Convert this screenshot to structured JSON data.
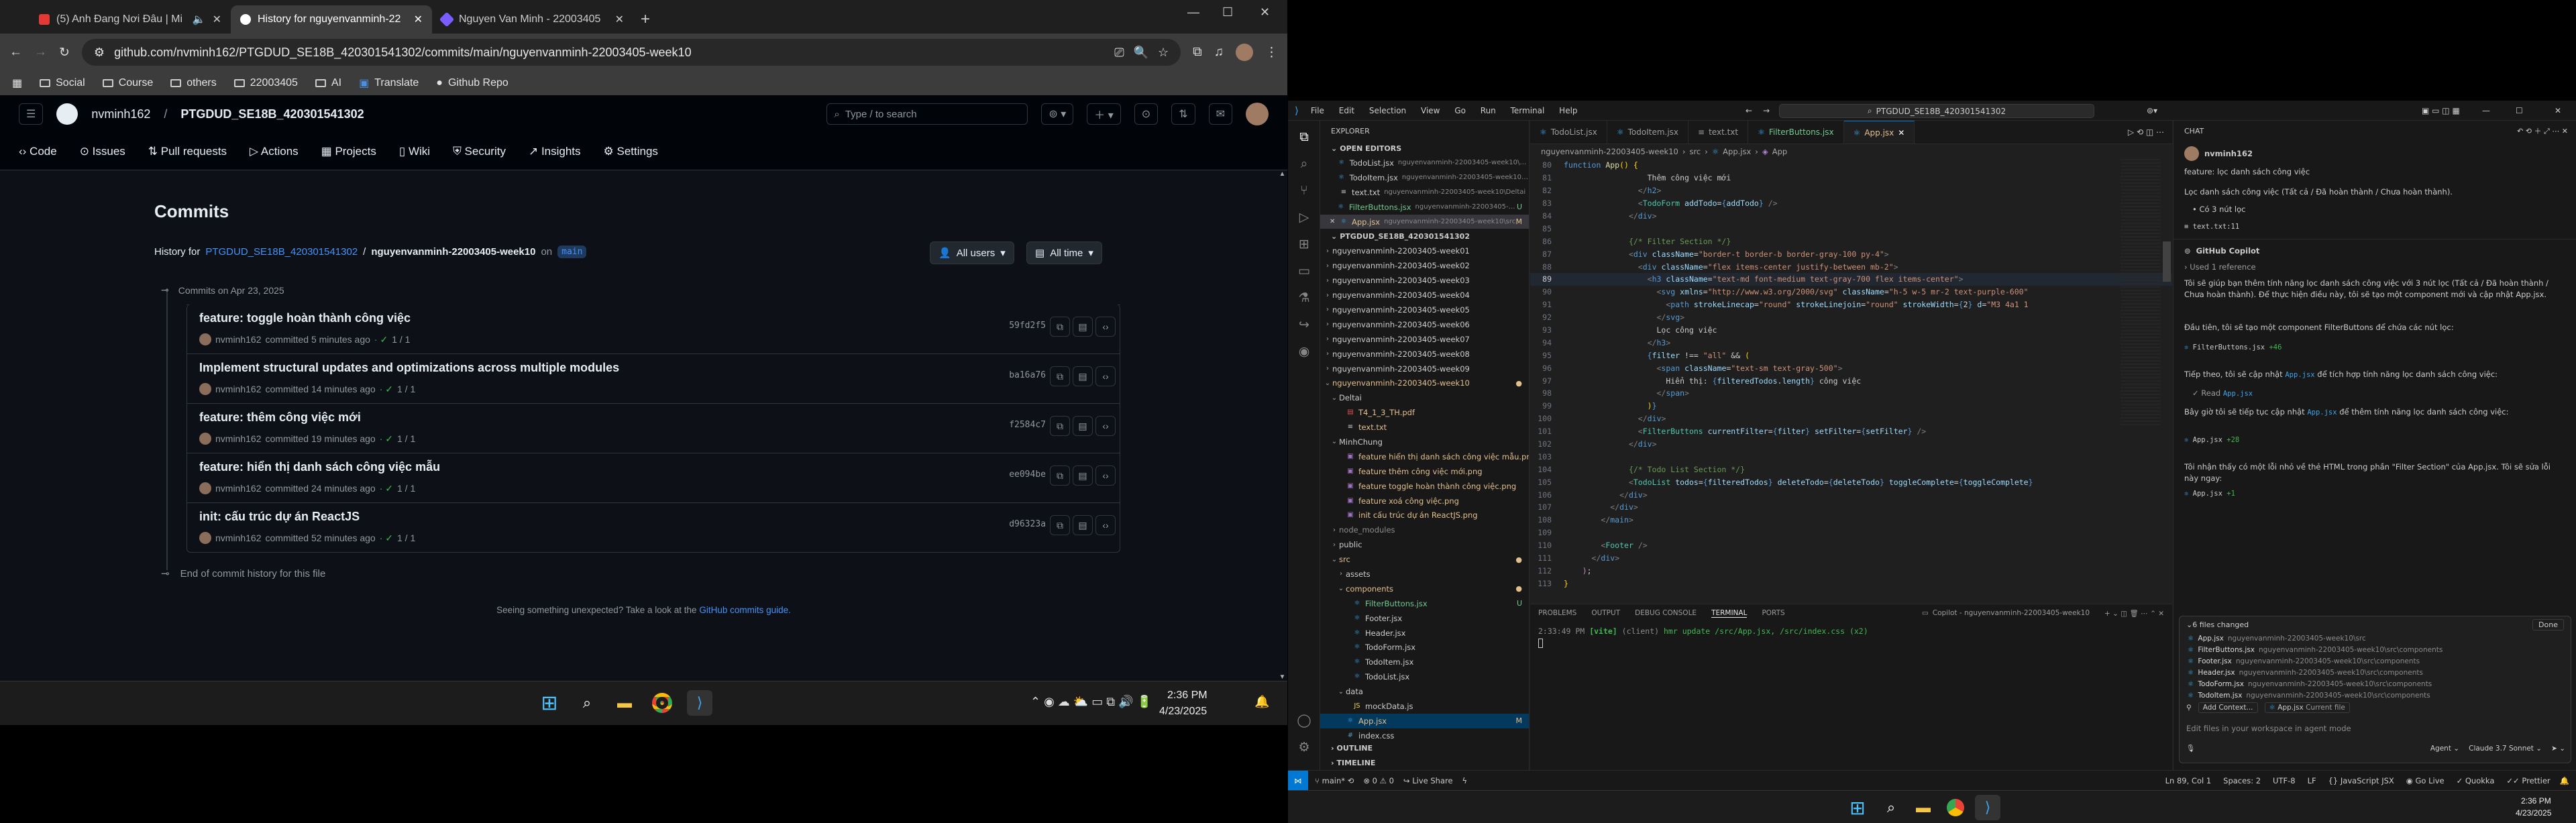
{
  "browser": {
    "tabs": [
      {
        "label": "(5) Anh Đang Nơi Đâu | Mi",
        "active": false
      },
      {
        "label": "History for nguyenvanminh-22",
        "active": true
      },
      {
        "label": "Nguyen Van Minh - 22003405",
        "active": false
      }
    ],
    "new_tab": "+",
    "url": "github.com/nvminh162/PTGDUD_SE18B_420301541302/commits/main/nguyenvanminh-22003405-week10",
    "bookmarks": [
      "Social",
      "Course",
      "others",
      "22003405",
      "AI",
      "Translate",
      "Github Repo"
    ]
  },
  "github": {
    "owner": "nvminh162",
    "repo": "PTGDUD_SE18B_420301541302",
    "search_placeholder": "Type / to search",
    "nav": [
      "Code",
      "Issues",
      "Pull requests",
      "Actions",
      "Projects",
      "Wiki",
      "Security",
      "Insights",
      "Settings"
    ],
    "page_title": "Commits",
    "history_label": "History for",
    "history_repo": "PTGDUD_SE18B_420301541302",
    "history_sep": "/",
    "history_path": "nguyenvanminh-22003405-week10",
    "history_on": "on",
    "branch": "main",
    "filter_users": "All users",
    "filter_time": "All time",
    "commits_date": "Commits on Apr 23, 2025",
    "commits": [
      {
        "title": "feature: toggle hoàn thành công việc",
        "author": "nvminh162",
        "time": "committed 5 minutes ago",
        "checks": "1 / 1",
        "sha": "59fd2f5"
      },
      {
        "title": "Implement structural updates and optimizations across multiple modules",
        "author": "nvminh162",
        "time": "committed 14 minutes ago",
        "checks": "1 / 1",
        "sha": "ba16a76"
      },
      {
        "title": "feature: thêm công việc mới",
        "author": "nvminh162",
        "time": "committed 19 minutes ago",
        "checks": "1 / 1",
        "sha": "f2584c7"
      },
      {
        "title": "feature: hiển thị danh sách công việc mẫu",
        "author": "nvminh162",
        "time": "committed 24 minutes ago",
        "checks": "1 / 1",
        "sha": "ee094be"
      },
      {
        "title": "init: cấu trúc dự án ReactJS",
        "author": "nvminh162",
        "time": "committed 52 minutes ago",
        "checks": "1 / 1",
        "sha": "d96323a"
      }
    ],
    "end_history": "End of commit history for this file",
    "footer_text": "Seeing something unexpected? Take a look at the",
    "footer_link": "GitHub commits guide."
  },
  "left_taskbar": {
    "time": "2:36 PM",
    "date": "4/23/2025"
  },
  "vscode": {
    "menu": [
      "File",
      "Edit",
      "Selection",
      "View",
      "Go",
      "Run",
      "Terminal",
      "Help"
    ],
    "search_text": "PTGDUD_SE18B_420301541302",
    "explorer_title": "EXPLORER",
    "open_editors_title": "OPEN EDITORS",
    "open_editors": [
      {
        "name": "TodoList.jsx",
        "path": "nguyenvanminh-22003405-week10\\src\\compone...",
        "badge": ""
      },
      {
        "name": "TodoItem.jsx",
        "path": "nguyenvanminh-22003405-week10\\src\\compon...",
        "badge": ""
      },
      {
        "name": "text.txt",
        "path": "nguyenvanminh-22003405-week10\\Deltai",
        "badge": ""
      },
      {
        "name": "FilterButtons.jsx",
        "path": "nguyenvanminh-22003405-week10\\src\\c...",
        "badge": "U"
      },
      {
        "name": "App.jsx",
        "path": "nguyenvanminh-22003405-week10\\src",
        "badge": "M"
      }
    ],
    "workspace_title": "PTGDUD_SE18B_420301541302",
    "tree": [
      {
        "label": "nguyenvanminh-22003405-week01",
        "depth": 1,
        "arrow": "›",
        "kind": "folder",
        "badge": ""
      },
      {
        "label": "nguyenvanminh-22003405-week02",
        "depth": 1,
        "arrow": "›",
        "kind": "folder",
        "badge": ""
      },
      {
        "label": "nguyenvanminh-22003405-week03",
        "depth": 1,
        "arrow": "›",
        "kind": "folder",
        "badge": ""
      },
      {
        "label": "nguyenvanminh-22003405-week04",
        "depth": 1,
        "arrow": "›",
        "kind": "folder",
        "badge": ""
      },
      {
        "label": "nguyenvanminh-22003405-week05",
        "depth": 1,
        "arrow": "›",
        "kind": "folder",
        "badge": ""
      },
      {
        "label": "nguyenvanminh-22003405-week06",
        "depth": 1,
        "arrow": "›",
        "kind": "folder",
        "badge": ""
      },
      {
        "label": "nguyenvanminh-22003405-week07",
        "depth": 1,
        "arrow": "›",
        "kind": "folder",
        "badge": ""
      },
      {
        "label": "nguyenvanminh-22003405-week08",
        "depth": 1,
        "arrow": "›",
        "kind": "folder",
        "badge": ""
      },
      {
        "label": "nguyenvanminh-22003405-week09",
        "depth": 1,
        "arrow": "›",
        "kind": "folder",
        "badge": ""
      },
      {
        "label": "nguyenvanminh-22003405-week10",
        "depth": 1,
        "arrow": "⌄",
        "kind": "folder",
        "badge": "●"
      },
      {
        "label": "Deltai",
        "depth": 2,
        "arrow": "⌄",
        "kind": "folder",
        "badge": ""
      },
      {
        "label": "T4_1_3_TH.pdf",
        "depth": 3,
        "arrow": "",
        "kind": "pdf",
        "badge": ""
      },
      {
        "label": "text.txt",
        "depth": 3,
        "arrow": "",
        "kind": "txt",
        "badge": ""
      },
      {
        "label": "MinhChung",
        "depth": 2,
        "arrow": "⌄",
        "kind": "folder",
        "badge": ""
      },
      {
        "label": "feature hiển thị danh sách công việc mẫu.png",
        "depth": 3,
        "arrow": "",
        "kind": "img",
        "badge": ""
      },
      {
        "label": "feature thêm công việc mới.png",
        "depth": 3,
        "arrow": "",
        "kind": "img",
        "badge": ""
      },
      {
        "label": "feature toggle hoàn thành công việc.png",
        "depth": 3,
        "arrow": "",
        "kind": "img",
        "badge": ""
      },
      {
        "label": "feature xoá công việc.png",
        "depth": 3,
        "arrow": "",
        "kind": "img",
        "badge": ""
      },
      {
        "label": "init cấu trúc dự án ReactJS.png",
        "depth": 3,
        "arrow": "",
        "kind": "img",
        "badge": ""
      },
      {
        "label": "node_modules",
        "depth": 2,
        "arrow": "›",
        "kind": "folder-dim",
        "badge": ""
      },
      {
        "label": "public",
        "depth": 2,
        "arrow": "›",
        "kind": "folder",
        "badge": ""
      },
      {
        "label": "src",
        "depth": 2,
        "arrow": "⌄",
        "kind": "folder",
        "badge": "●"
      },
      {
        "label": "assets",
        "depth": 3,
        "arrow": "›",
        "kind": "folder",
        "badge": ""
      },
      {
        "label": "components",
        "depth": 3,
        "arrow": "⌄",
        "kind": "folder-mod",
        "badge": "●"
      },
      {
        "label": "FilterButtons.jsx",
        "depth": 4,
        "arrow": "",
        "kind": "jsx-new",
        "badge": "U"
      },
      {
        "label": "Footer.jsx",
        "depth": 4,
        "arrow": "",
        "kind": "jsx",
        "badge": ""
      },
      {
        "label": "Header.jsx",
        "depth": 4,
        "arrow": "",
        "kind": "jsx",
        "badge": ""
      },
      {
        "label": "TodoForm.jsx",
        "depth": 4,
        "arrow": "",
        "kind": "jsx",
        "badge": ""
      },
      {
        "label": "TodoItem.jsx",
        "depth": 4,
        "arrow": "",
        "kind": "jsx",
        "badge": ""
      },
      {
        "label": "TodoList.jsx",
        "depth": 4,
        "arrow": "",
        "kind": "jsx",
        "badge": ""
      },
      {
        "label": "data",
        "depth": 3,
        "arrow": "⌄",
        "kind": "folder",
        "badge": ""
      },
      {
        "label": "mockData.js",
        "depth": 4,
        "arrow": "",
        "kind": "js",
        "badge": ""
      },
      {
        "label": "App.jsx",
        "depth": 3,
        "arrow": "",
        "kind": "jsx-mod",
        "badge": "M"
      },
      {
        "label": "index.css",
        "depth": 3,
        "arrow": "",
        "kind": "css",
        "badge": ""
      }
    ],
    "outline": "OUTLINE",
    "timeline": "TIMELINE",
    "editor_tabs": [
      {
        "label": "TodoList.jsx",
        "active": false
      },
      {
        "label": "TodoItem.jsx",
        "active": false
      },
      {
        "label": "text.txt",
        "active": false
      },
      {
        "label": "FilterButtons.jsx",
        "active": false
      },
      {
        "label": "App.jsx",
        "active": true
      }
    ],
    "breadcrumb": [
      "nguyenvanminh-22003405-week10",
      "src",
      "App.jsx",
      "App"
    ],
    "code_lines": [
      {
        "n": "80",
        "html": "<span class='k'>function</span> <span class='f'>App</span><span class='y'>()</span> <span class='y'>{</span>"
      },
      {
        "n": "81",
        "html": "                  Thêm công việc mới"
      },
      {
        "n": "82",
        "html": "                <span class='p'>&lt;/</span><span class='k'>h2</span><span class='p'>&gt;</span>"
      },
      {
        "n": "83",
        "html": "                <span class='p'>&lt;</span><span class='t'>TodoForm</span> <span class='a'>addTodo</span>=<span class='k'>{</span><span class='a'>addTodo</span><span class='k'>}</span> <span class='p'>/&gt;</span>"
      },
      {
        "n": "84",
        "html": "              <span class='p'>&lt;/</span><span class='k'>div</span><span class='p'>&gt;</span>"
      },
      {
        "n": "85",
        "html": ""
      },
      {
        "n": "86",
        "html": "              <span class='c'>{/* Filter Section */}</span>"
      },
      {
        "n": "87",
        "html": "              <span class='p'>&lt;</span><span class='k'>div</span> <span class='a'>className</span>=<span class='s'>\"border-t border-b border-gray-100 py-4\"</span><span class='p'>&gt;</span>"
      },
      {
        "n": "88",
        "html": "                <span class='p'>&lt;</span><span class='k'>div</span> <span class='a'>className</span>=<span class='s'>\"flex items-center justify-between mb-2\"</span><span class='p'>&gt;</span>"
      },
      {
        "n": "89",
        "html": "                  <span class='p'>&lt;</span><span class='k'>h3</span> <span class='a'>className</span>=<span class='s'>\"text-md font-medium text-gray-700 flex items-center\"</span><span class='p'>&gt;</span>"
      },
      {
        "n": "90",
        "html": "                    <span class='p'>&lt;</span><span class='k'>svg</span> <span class='a'>xmlns</span>=<span class='s'>\"http://www.w3.org/2000/svg\"</span> <span class='a'>className</span>=<span class='s'>\"h-5 w-5 mr-2 text-purple-600\"</span>"
      },
      {
        "n": "91",
        "html": "                      <span class='p'>&lt;</span><span class='k'>path</span> <span class='a'>strokeLinecap</span>=<span class='s'>\"round\"</span> <span class='a'>strokeLinejoin</span>=<span class='s'>\"round\"</span> <span class='a'>strokeWidth</span>=<span class='k'>{</span>2<span class='k'>}</span> <span class='a'>d</span>=<span class='s'>\"M3 4a1 1</span>"
      },
      {
        "n": "92",
        "html": "                    <span class='p'>&lt;/</span><span class='k'>svg</span><span class='p'>&gt;</span>"
      },
      {
        "n": "93",
        "html": "                    Lọc công việc"
      },
      {
        "n": "94",
        "html": "                  <span class='p'>&lt;/</span><span class='k'>h3</span><span class='p'>&gt;</span>"
      },
      {
        "n": "95",
        "html": "                  <span class='k'>{</span><span class='a'>filter</span> !== <span class='s'>\"all\"</span> &amp;&amp; <span class='y'>(</span>"
      },
      {
        "n": "96",
        "html": "                    <span class='p'>&lt;</span><span class='k'>span</span> <span class='a'>className</span>=<span class='s'>\"text-sm text-gray-500\"</span><span class='p'>&gt;</span>"
      },
      {
        "n": "97",
        "html": "                      Hiển thị: <span class='k'>{</span><span class='a'>filteredTodos</span>.<span class='a'>length</span><span class='k'>}</span> công việc"
      },
      {
        "n": "98",
        "html": "                    <span class='p'>&lt;/</span><span class='k'>span</span><span class='p'>&gt;</span>"
      },
      {
        "n": "99",
        "html": "                  <span class='y'>)</span><span class='k'>}</span>"
      },
      {
        "n": "100",
        "html": "                <span class='p'>&lt;/</span><span class='k'>div</span><span class='p'>&gt;</span>"
      },
      {
        "n": "101",
        "html": "                <span class='p'>&lt;</span><span class='t'>FilterButtons</span> <span class='a'>currentFilter</span>=<span class='k'>{</span><span class='a'>filter</span><span class='k'>}</span> <span class='a'>setFilter</span>=<span class='k'>{</span><span class='a'>setFilter</span><span class='k'>}</span> <span class='p'>/&gt;</span>"
      },
      {
        "n": "102",
        "html": "              <span class='p'>&lt;/</span><span class='k'>div</span><span class='p'>&gt;</span>"
      },
      {
        "n": "103",
        "html": ""
      },
      {
        "n": "104",
        "html": "              <span class='c'>{/* Todo List Section */}</span>"
      },
      {
        "n": "105",
        "html": "              <span class='p'>&lt;</span><span class='t'>TodoList</span> <span class='a'>todos</span>=<span class='k'>{</span><span class='a'>filteredTodos</span><span class='k'>}</span> <span class='a'>deleteTodo</span>=<span class='k'>{</span><span class='a'>deleteTodo</span><span class='k'>}</span> <span class='a'>toggleComplete</span>=<span class='k'>{</span><span class='a'>toggleComplete</span><span class='k'>}</span>"
      },
      {
        "n": "106",
        "html": "            <span class='p'>&lt;/</span><span class='k'>div</span><span class='p'>&gt;</span>"
      },
      {
        "n": "107",
        "html": "          <span class='p'>&lt;/</span><span class='k'>div</span><span class='p'>&gt;</span>"
      },
      {
        "n": "108",
        "html": "        <span class='p'>&lt;/</span><span class='k'>main</span><span class='p'>&gt;</span>"
      },
      {
        "n": "109",
        "html": ""
      },
      {
        "n": "110",
        "html": "        <span class='p'>&lt;</span><span class='t'>Footer</span> <span class='p'>/&gt;</span>"
      },
      {
        "n": "111",
        "html": "      <span class='p'>&lt;/</span><span class='k'>div</span><span class='p'>&gt;</span>"
      },
      {
        "n": "112",
        "html": "    <span class='v'>)</span>;"
      },
      {
        "n": "113",
        "html": "<span class='y'>}</span>"
      }
    ],
    "panel_tabs": [
      "PROBLEMS",
      "OUTPUT",
      "DEBUG CONSOLE",
      "TERMINAL",
      "PORTS"
    ],
    "terminal_name": "Copilot - nguyenvanminh-22003405-week10",
    "terminal_time": "2:33:49 PM",
    "terminal_tag": "[vite]",
    "terminal_client": "(client)",
    "terminal_msg": "hmr update /src/App.jsx, /src/index.css (x2)",
    "chat": {
      "title": "CHAT",
      "user": "nvminh162",
      "prompt_title": "feature: lọc danh sách công việc",
      "prompt_body": "Lọc danh sách công việc (Tất cả / Đã hoàn thành / Chưa hoàn thành).",
      "prompt_bullet": "Có 3 nút lọc",
      "prompt_ref": "text.txt:11",
      "assistant": "GitHub Copilot",
      "used_ref": "Used 1 reference",
      "p1": "Tôi sẽ giúp bạn thêm tính năng lọc danh sách công việc với 3 nút lọc (Tất cả / Đã hoàn thành / Chưa hoàn thành). Để thực hiện điều này, tôi sẽ tạo một component mới và cập nhật App.jsx.",
      "p2": "Đầu tiên, tôi sẽ tạo một component FilterButtons để chứa các nút lọc:",
      "file1": "FilterButtons.jsx",
      "file1_diff": "+46",
      "p3a": "Tiếp theo, tôi sẽ cập nhật",
      "p3file": "App.jsx",
      "p3b": "để tích hợp tính năng lọc danh sách công việc:",
      "read": "Read",
      "read_file": "App.jsx",
      "p4a": "Bây giờ tôi sẽ tiếp tục cập nhật",
      "p4file": "App.jsx",
      "p4b": "để thêm tính năng lọc danh sách công việc:",
      "file2": "App.jsx",
      "file2_diff": "+28",
      "p5": "Tôi nhận thấy có một lỗi nhỏ về thẻ HTML trong phần \"Filter Section\" của App.jsx. Tôi sẽ sửa lỗi này ngay:",
      "file3": "App.jsx",
      "file3_diff": "+1",
      "files_changed": "6 files changed",
      "done": "Done",
      "changed_files": [
        {
          "name": "App.jsx",
          "path": "nguyenvanminh-22003405-week10\\src"
        },
        {
          "name": "FilterButtons.jsx",
          "path": "nguyenvanminh-22003405-week10\\src\\components"
        },
        {
          "name": "Footer.jsx",
          "path": "nguyenvanminh-22003405-week10\\src\\components"
        },
        {
          "name": "Header.jsx",
          "path": "nguyenvanminh-22003405-week10\\src\\components"
        },
        {
          "name": "TodoForm.jsx",
          "path": "nguyenvanminh-22003405-week10\\src\\components"
        },
        {
          "name": "TodoItem.jsx",
          "path": "nguyenvanminh-22003405-week10\\src\\components"
        }
      ],
      "add_context": "Add Context...",
      "current_file": "App.jsx",
      "current_file_label": "Current file",
      "input_placeholder": "Edit files in your workspace in agent mode",
      "mode": "Agent",
      "model": "Claude 3.7 Sonnet"
    },
    "status": {
      "branch": "main*",
      "errors": "0",
      "warnings": "0",
      "live_share": "Live Share",
      "position": "Ln 89, Col 1",
      "spaces": "Spaces: 2",
      "encoding": "UTF-8",
      "eol": "LF",
      "language": "JavaScript JSX",
      "golive": "Go Live",
      "quokka": "Quokka",
      "prettier": "Prettier"
    }
  },
  "right_taskbar": {
    "time": "2:36 PM",
    "date": "4/23/2025"
  }
}
